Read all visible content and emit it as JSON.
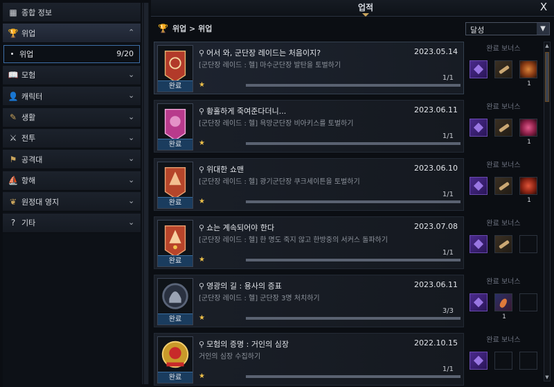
{
  "window": {
    "title": "업적",
    "close": "X"
  },
  "sidebar": {
    "items": [
      {
        "label": "종합 정보",
        "icon": "grid-icon",
        "open": false
      },
      {
        "label": "위업",
        "icon": "trophy-icon",
        "open": true
      },
      {
        "label": "모험",
        "icon": "book-icon",
        "open": false
      },
      {
        "label": "캐릭터",
        "icon": "person-icon",
        "open": false
      },
      {
        "label": "생활",
        "icon": "feather-icon",
        "open": false
      },
      {
        "label": "전투",
        "icon": "crossed-swords-icon",
        "open": false
      },
      {
        "label": "공격대",
        "icon": "raid-icon",
        "open": false
      },
      {
        "label": "항해",
        "icon": "ship-icon",
        "open": false
      },
      {
        "label": "원정대 영지",
        "icon": "laurel-icon",
        "open": false
      },
      {
        "label": "기타",
        "icon": "question-icon",
        "open": false
      }
    ],
    "subitem": {
      "label": "위업",
      "count": "9/20"
    }
  },
  "header": {
    "breadcrumb": "위업 > 위업",
    "filter_value": "달성"
  },
  "bonus_title": "완료 보너스",
  "done_label": "완료",
  "achievements": [
    {
      "name": "어서 와, 군단장 레이드는 처음이지?",
      "date": "2023.05.14",
      "desc": "[군단장 레이드 : 헬] 마수군단장 발탄을 토벌하기",
      "progress": "1/1",
      "progress_ratio": 1.0,
      "emblem_color": "#b23a2a",
      "rewards": [
        "purple-card-icon",
        "scroll-icon",
        "orb-icon"
      ],
      "reward_qty": "1"
    },
    {
      "name": "황홀하게 죽여준다더니...",
      "date": "2023.06.11",
      "desc": "[군단장 레이드 : 헬] 욕망군단장 비아키스를 토벌하기",
      "progress": "1/1",
      "progress_ratio": 1.0,
      "emblem_color": "#b83a8c",
      "rewards": [
        "purple-card-icon",
        "scroll-icon",
        "rose-icon"
      ],
      "reward_qty": "1"
    },
    {
      "name": "위대한 쇼맨",
      "date": "2023.06.10",
      "desc": "[군단장 레이드 : 헬] 광기군단장 쿠크세이튼을 토벌하기",
      "progress": "1/1",
      "progress_ratio": 1.0,
      "emblem_color": "#b5452a",
      "rewards": [
        "purple-card-icon",
        "scroll-icon",
        "red-orb-icon"
      ],
      "reward_qty": "1"
    },
    {
      "name": "쇼는 계속되어야 한다",
      "date": "2023.07.08",
      "desc": "[군단장 레이드 : 헬] 한 명도 죽지 않고 한방중의 서커스 돌파하기",
      "progress": "1/1",
      "progress_ratio": 1.0,
      "emblem_color": "#b8442a",
      "rewards": [
        "purple-card-icon",
        "scroll-icon",
        "empty"
      ],
      "reward_qty": ""
    },
    {
      "name": "영광의 길 : 용사의 증표",
      "date": "2023.06.11",
      "desc": "[군단장 레이드 : 헬] 군단장 3명 처치하기",
      "progress": "3/3",
      "progress_ratio": 1.0,
      "emblem_color": "#5a6478",
      "rewards": [
        "purple-card-icon",
        "feather-icon",
        "empty"
      ],
      "reward_qty": "1"
    },
    {
      "name": "모험의 증명 : 거인의 심장",
      "date": "2022.10.15",
      "desc": "거인의 심장 수집하기",
      "progress": "1/1",
      "progress_ratio": 1.0,
      "emblem_color": "#c99a2a",
      "rewards": [
        "purple-card-icon",
        "empty",
        "empty"
      ],
      "reward_qty": ""
    }
  ],
  "colors": {
    "accent_gold": "#c9a45c",
    "done_blue": "#1a3c5e",
    "star": "#f0c24a"
  }
}
